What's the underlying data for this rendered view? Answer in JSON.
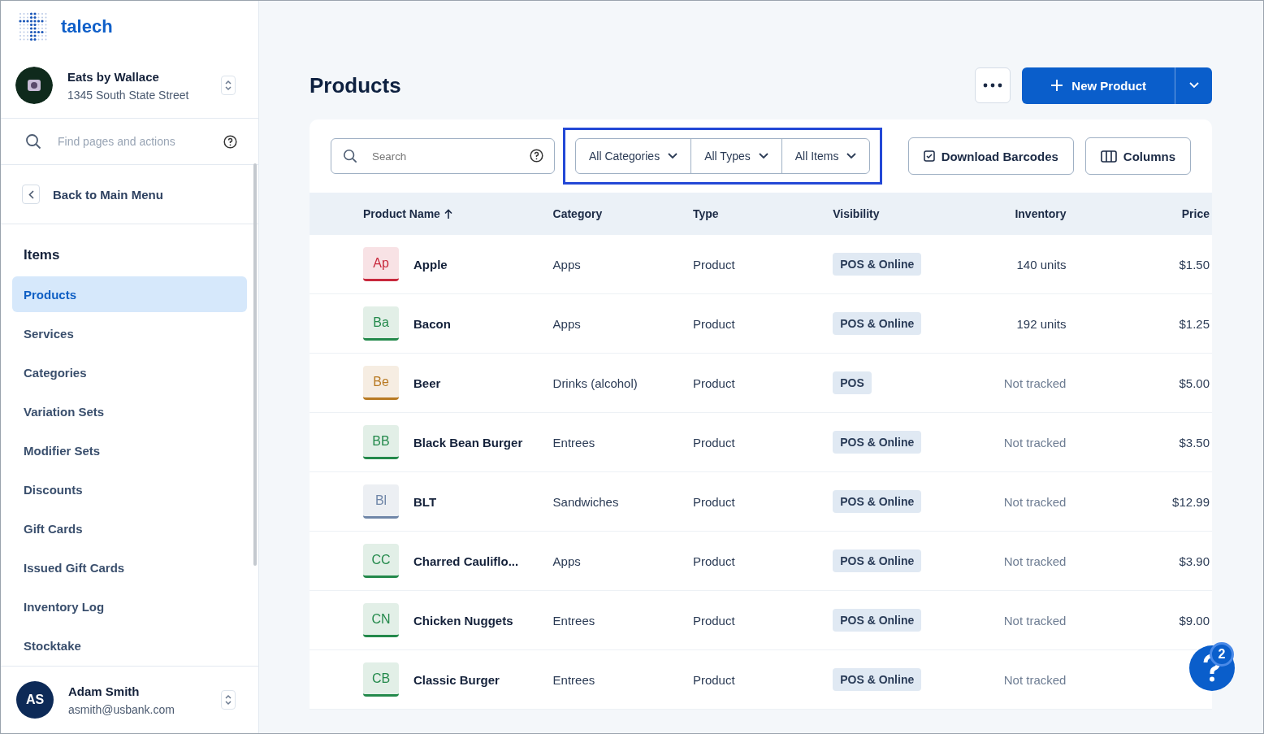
{
  "brand": {
    "name": "talech"
  },
  "account": {
    "name": "Eats by Wallace",
    "address": "1345 South State Street"
  },
  "find": {
    "placeholder": "Find pages and actions"
  },
  "back": {
    "label": "Back to Main Menu"
  },
  "sidebar": {
    "section": "Items",
    "items": [
      {
        "label": "Products",
        "selected": true
      },
      {
        "label": "Services",
        "selected": false
      },
      {
        "label": "Categories",
        "selected": false
      },
      {
        "label": "Variation Sets",
        "selected": false
      },
      {
        "label": "Modifier Sets",
        "selected": false
      },
      {
        "label": "Discounts",
        "selected": false
      },
      {
        "label": "Gift Cards",
        "selected": false
      },
      {
        "label": "Issued Gift Cards",
        "selected": false
      },
      {
        "label": "Inventory Log",
        "selected": false
      },
      {
        "label": "Stocktake",
        "selected": false
      }
    ]
  },
  "user": {
    "initials": "AS",
    "name": "Adam Smith",
    "email": "asmith@usbank.com"
  },
  "page": {
    "title": "Products",
    "new_button": "New Product"
  },
  "search": {
    "placeholder": "Search"
  },
  "filters": [
    "All Categories",
    "All Types",
    "All Items"
  ],
  "actions": {
    "download": "Download Barcodes",
    "columns": "Columns"
  },
  "table": {
    "columns": [
      "Product Name",
      "Category",
      "Type",
      "Visibility",
      "Inventory",
      "Price"
    ],
    "rows": [
      {
        "initials": "Ap",
        "color": "#c8283c",
        "name": "Apple",
        "category": "Apps",
        "type": "Product",
        "visibility": "POS & Online",
        "inventory": "140 units",
        "tracked": true,
        "price": "$1.50"
      },
      {
        "initials": "Ba",
        "color": "#23894b",
        "name": "Bacon",
        "category": "Apps",
        "type": "Product",
        "visibility": "POS & Online",
        "inventory": "192 units",
        "tracked": true,
        "price": "$1.25"
      },
      {
        "initials": "Be",
        "color": "#b87a22",
        "name": "Beer",
        "category": "Drinks (alcohol)",
        "type": "Product",
        "visibility": "POS",
        "inventory": "Not tracked",
        "tracked": false,
        "price": "$5.00"
      },
      {
        "initials": "BB",
        "color": "#23894b",
        "name": "Black Bean Burger",
        "category": "Entrees",
        "type": "Product",
        "visibility": "POS & Online",
        "inventory": "Not tracked",
        "tracked": false,
        "price": "$3.50"
      },
      {
        "initials": "Bl",
        "color": "#6f86a8",
        "name": "BLT",
        "category": "Sandwiches",
        "type": "Product",
        "visibility": "POS & Online",
        "inventory": "Not tracked",
        "tracked": false,
        "price": "$12.99"
      },
      {
        "initials": "CC",
        "color": "#23894b",
        "name": "Charred Cauliflo...",
        "category": "Apps",
        "type": "Product",
        "visibility": "POS & Online",
        "inventory": "Not tracked",
        "tracked": false,
        "price": "$3.90"
      },
      {
        "initials": "CN",
        "color": "#23894b",
        "name": "Chicken Nuggets",
        "category": "Entrees",
        "type": "Product",
        "visibility": "POS & Online",
        "inventory": "Not tracked",
        "tracked": false,
        "price": "$9.00"
      },
      {
        "initials": "CB",
        "color": "#23894b",
        "name": "Classic Burger",
        "category": "Entrees",
        "type": "Product",
        "visibility": "POS & Online",
        "inventory": "Not tracked",
        "tracked": false
      }
    ]
  },
  "help": {
    "badge": "2"
  }
}
